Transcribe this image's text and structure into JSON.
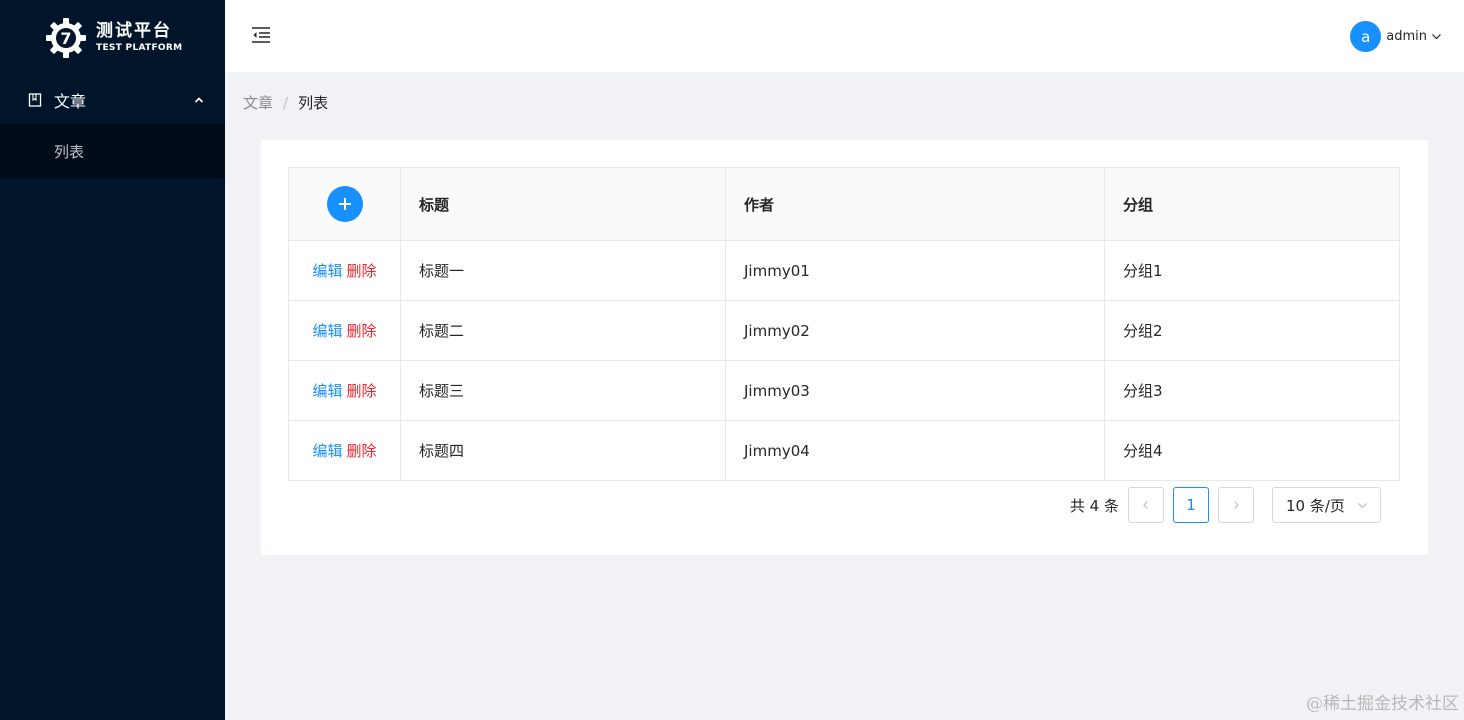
{
  "sidebar": {
    "logo": {
      "title_cn": "测试平台",
      "title_en": "TEST PLATFORM",
      "mark_letter": "7"
    },
    "menu": {
      "group_label": "文章",
      "items": [
        {
          "label": "列表"
        }
      ]
    }
  },
  "header": {
    "user": {
      "avatar_letter": "a",
      "name": "admin"
    }
  },
  "breadcrumb": {
    "parent": "文章",
    "separator": "/",
    "current": "列表"
  },
  "table": {
    "columns": [
      "标题",
      "作者",
      "分组"
    ],
    "action_labels": {
      "edit": "编辑",
      "delete": "删除"
    },
    "rows": [
      {
        "title": "标题一",
        "author": "Jimmy01",
        "group": "分组1"
      },
      {
        "title": "标题二",
        "author": "Jimmy02",
        "group": "分组2"
      },
      {
        "title": "标题三",
        "author": "Jimmy03",
        "group": "分组3"
      },
      {
        "title": "标题四",
        "author": "Jimmy04",
        "group": "分组4"
      }
    ]
  },
  "pagination": {
    "total_text": "共 4 条",
    "current_page": "1",
    "page_size": "10 条/页"
  },
  "watermark": "@稀土掘金技术社区",
  "colors": {
    "sidebar_bg": "#001529",
    "submenu_bg": "#000c17",
    "primary": "#1890ff",
    "danger": "#f5222d"
  }
}
